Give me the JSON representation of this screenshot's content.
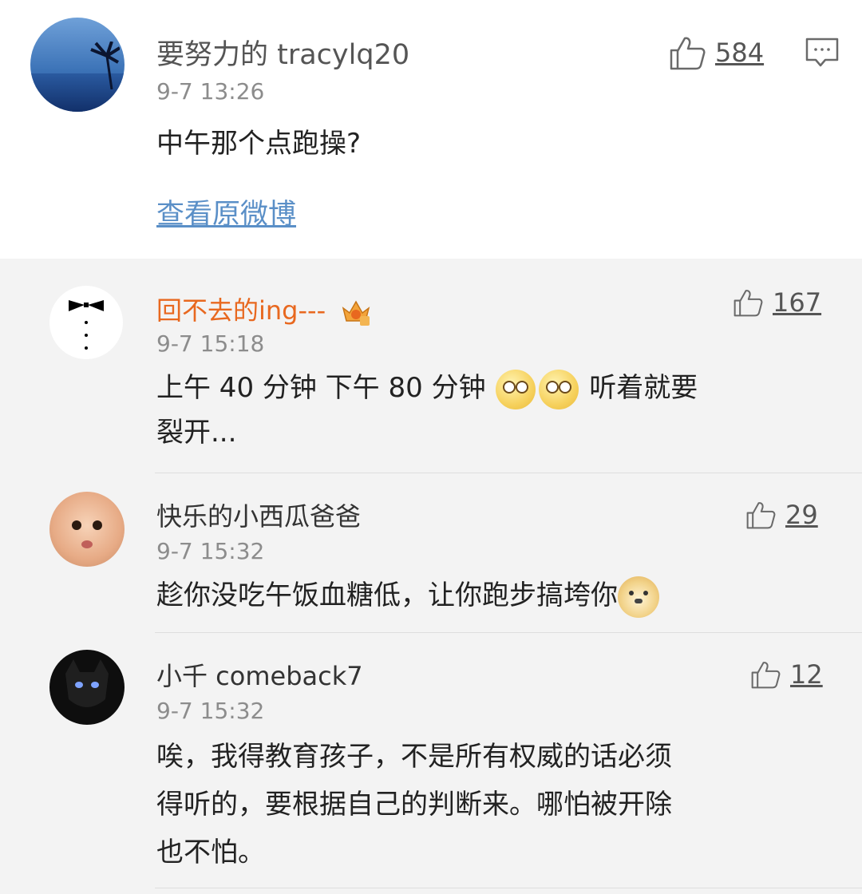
{
  "top_comment": {
    "username": "要努力的 tracylq20",
    "time": "9-7 13:26",
    "text": "中午那个点跑操?",
    "likes": "584",
    "view_original": "查看原微博",
    "avatar_icon": "sunset-sea-avatar",
    "like_icon": "thumbs-up-icon",
    "comment_icon": "comment-bubble-icon"
  },
  "replies": [
    {
      "username": "回不去的ing---",
      "username_color": "#e8681f",
      "badge_icon": "vip-crown-badge-icon",
      "time": "9-7 15:18",
      "text_part1": "上午 40 分钟  下午 80 分钟",
      "text_part2": "听着就要裂开...",
      "text_line2": "裂开...",
      "text_line1_end": "听着就要",
      "emoji": "dizzy-face-emoji",
      "likes": "167"
    },
    {
      "username": "快乐的小西瓜爸爸",
      "username_color": "#333333",
      "time": "9-7 15:32",
      "text": "趁你没吃午饭血糖低，让你跑步搞垮你",
      "emoji": "doge-emoji",
      "likes": "29"
    },
    {
      "username": "小千 comeback7",
      "username_color": "#333333",
      "time": "9-7 15:32",
      "text_line1": "唉，我得教育孩子，不是所有权威的话必须",
      "text_line2": "得听的，要根据自己的判断来。哪怕被开除",
      "text_line3": "也不怕。",
      "likes": "12"
    }
  ],
  "colors": {
    "link": "#5a8fc7",
    "reply_bg": "#f3f3f3",
    "time": "#8c8c8c"
  }
}
